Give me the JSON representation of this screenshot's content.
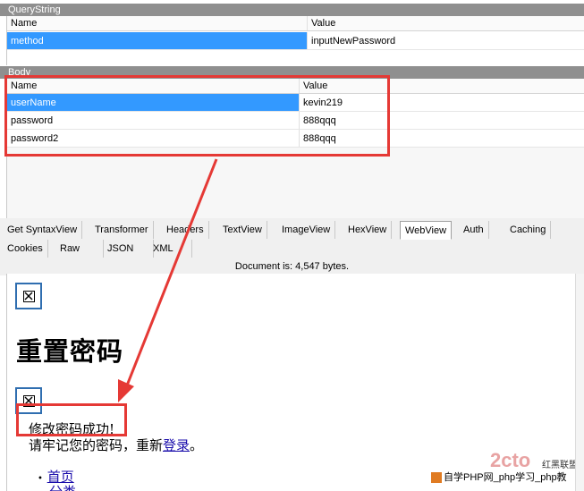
{
  "querystring": {
    "title": "QueryString",
    "col_name": "Name",
    "col_value": "Value",
    "rows": [
      {
        "name": "method",
        "value": "inputNewPassword"
      }
    ]
  },
  "body": {
    "title": "Body",
    "col_name": "Name",
    "col_value": "Value",
    "rows": [
      {
        "name": "userName",
        "value": "kevin219"
      },
      {
        "name": "password",
        "value": "888qqq"
      },
      {
        "name": "password2",
        "value": "888qqq"
      }
    ]
  },
  "tabs_row1": [
    "Get SyntaxView",
    "Transformer",
    "Headers",
    "TextView",
    "ImageView",
    "HexView",
    "WebView",
    "Auth",
    "Caching"
  ],
  "tabs_row2": [
    "Cookies",
    "Raw",
    "JSON",
    "XML"
  ],
  "active_tab": "WebView",
  "status": "Document is: 4,547 bytes.",
  "webview": {
    "heading": "重置密码",
    "success_msg": "修改密码成功!",
    "relogin_prefix": "请牢记您的密码，重新",
    "relogin_link": "登录",
    "relogin_suffix": "。",
    "nav_items": [
      "首页",
      "分类"
    ]
  },
  "watermark": {
    "site_text": "自学PHP网_php学习_php教",
    "brand_cn": "红黑联盟"
  },
  "colors": {
    "header_bg": "#8f8f8f",
    "selection": "#3399ff",
    "annotation_red": "#e53935",
    "link": "#1a0dab"
  }
}
